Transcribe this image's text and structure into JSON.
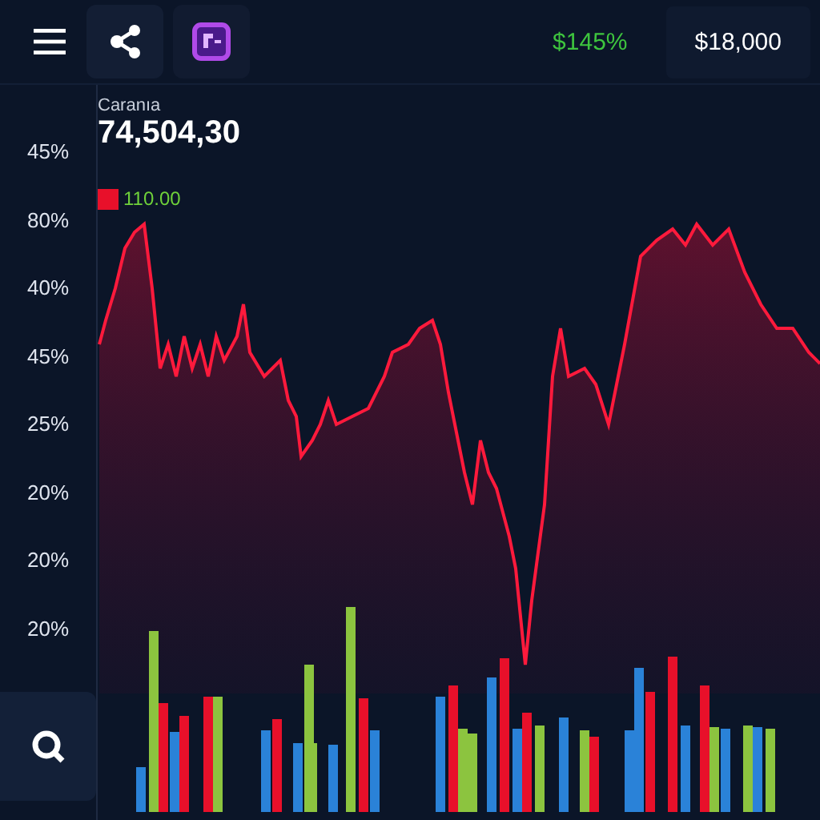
{
  "toolbar": {
    "change": "$145%",
    "balance": "$18,000"
  },
  "summary": {
    "label": "Caranıa",
    "value": "74,504,30"
  },
  "legend": {
    "color": "#e8102a",
    "value": "110.00"
  },
  "axis_labels": [
    "45%",
    "80%",
    "40%",
    "45%",
    "25%",
    "20%",
    "20%",
    "20%"
  ]
}
